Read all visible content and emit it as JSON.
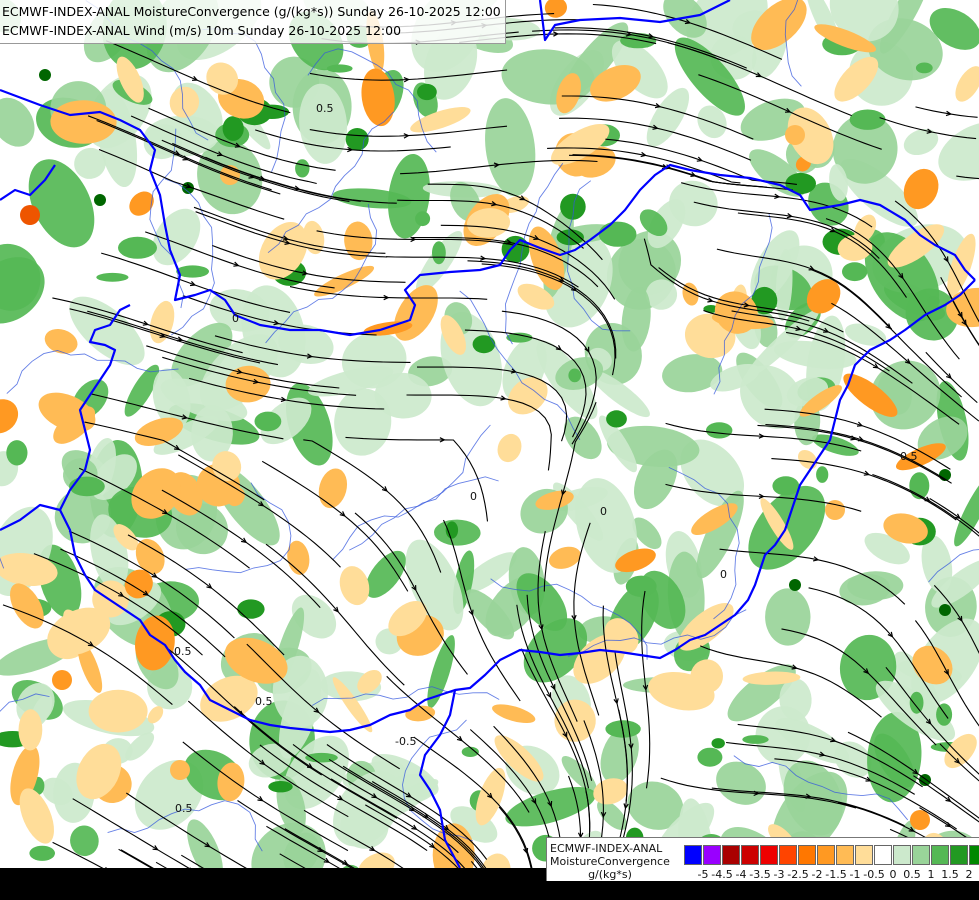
{
  "title": {
    "line1": "ECMWF-INDEX-ANAL MoistureConvergence (g/(kg*s)) Sunday 26-10-2025 12:00",
    "line2": "ECMWF-INDEX-ANAL Wind (m/s) 10m Sunday 26-10-2025 12:00"
  },
  "legend": {
    "line1": "ECMWF-INDEX-ANAL",
    "line2": "MoistureConvergence",
    "line3": "g/(kg*s)",
    "tick_labels": [
      "-5",
      "-4.5",
      "-4",
      "-3.5",
      "-3",
      "-2.5",
      "-2",
      "-1.5",
      "-1",
      "-0.5",
      "0",
      "0.5",
      "1",
      "1.5",
      "2"
    ],
    "colors": [
      "#0000ff",
      "#9900ff",
      "#aa0000",
      "#cc0000",
      "#ee0000",
      "#ff4400",
      "#ff7700",
      "#ff9922",
      "#ffbb55",
      "#ffdd99",
      "#ffffff",
      "#cce9cc",
      "#99d499",
      "#55b855",
      "#229922",
      "#008800"
    ]
  },
  "map_labels": {
    "contour_values": [
      "0.5",
      "0",
      "-0.5",
      "0",
      "0.5",
      "0",
      "0.5",
      "-0.5",
      "0",
      "0.5"
    ]
  },
  "colors": {
    "border": "#0000ff",
    "river": "#3355dd",
    "streamline": "#000000",
    "positive": "#99d499",
    "negative": "#ffbb55"
  }
}
